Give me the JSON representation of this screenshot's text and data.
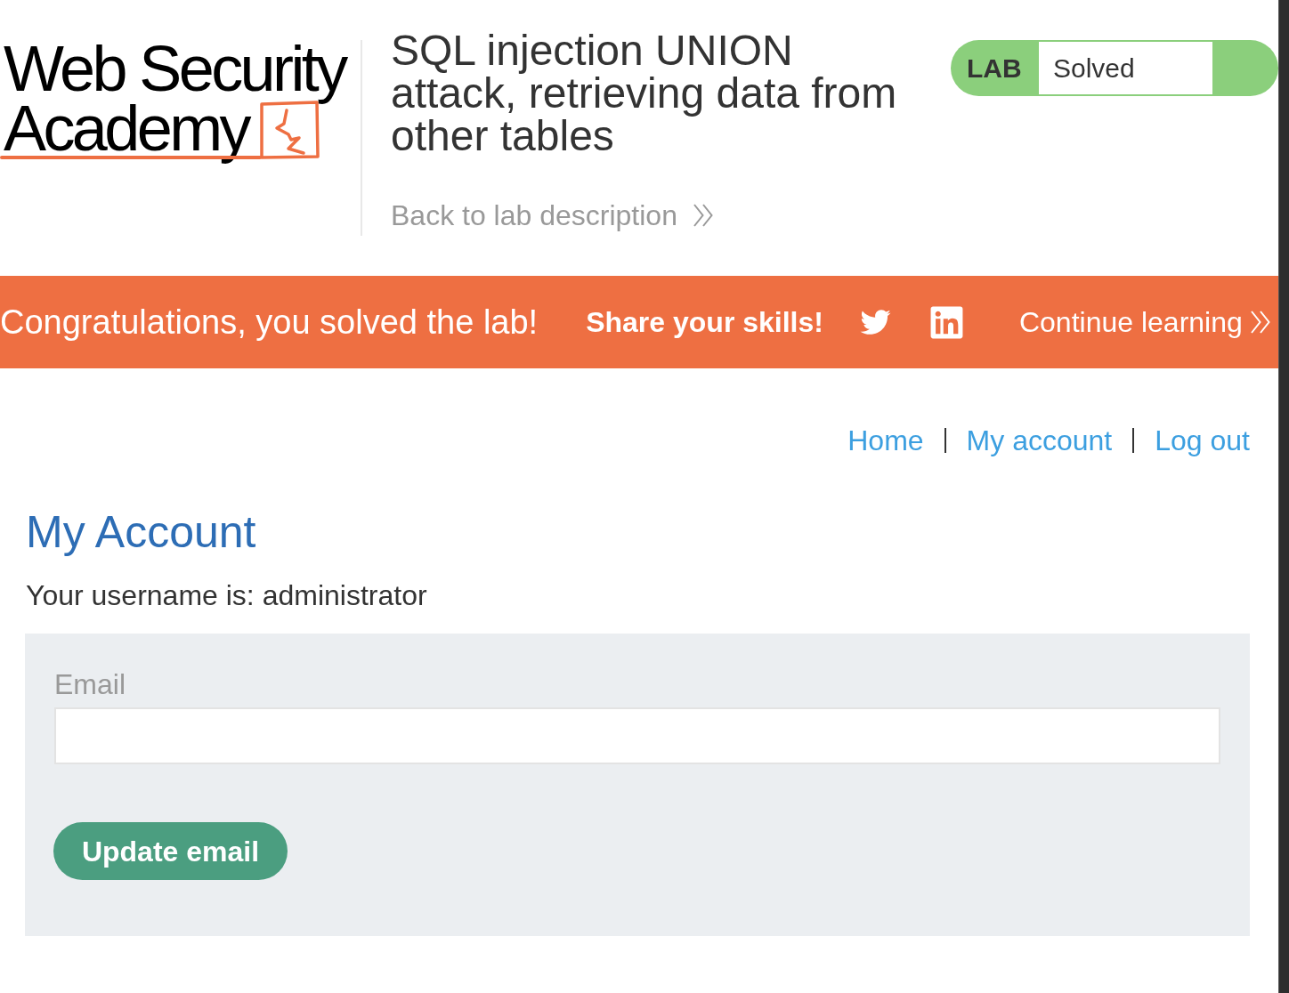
{
  "header": {
    "logo": {
      "lines": [
        "Web Security",
        "Academy"
      ]
    },
    "title": "SQL injection UNION attack, retrieving data from other tables",
    "back_link": "Back to lab description",
    "status_badge": {
      "label": "LAB",
      "status": "Solved",
      "solved": true
    }
  },
  "banner": {
    "message": "Congratulations, you solved the lab!",
    "share_label": "Share your skills!",
    "continue_link": "Continue learning"
  },
  "nav": [
    "Home",
    "My account",
    "Log out"
  ],
  "account": {
    "heading": "My Account",
    "username_line": "Your username is: administrator",
    "email_label": "Email",
    "update_button": "Update email"
  }
}
